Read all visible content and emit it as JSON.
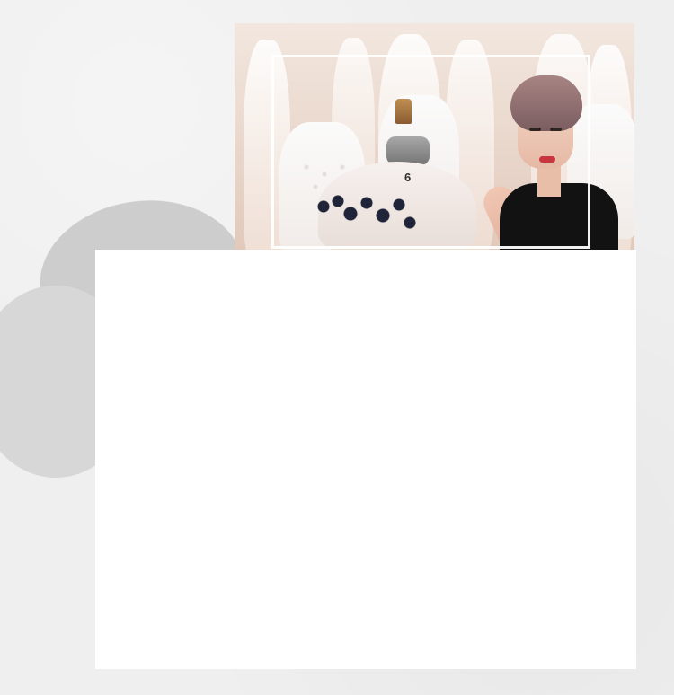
{
  "photo": {
    "mannequin_tag": "6"
  }
}
